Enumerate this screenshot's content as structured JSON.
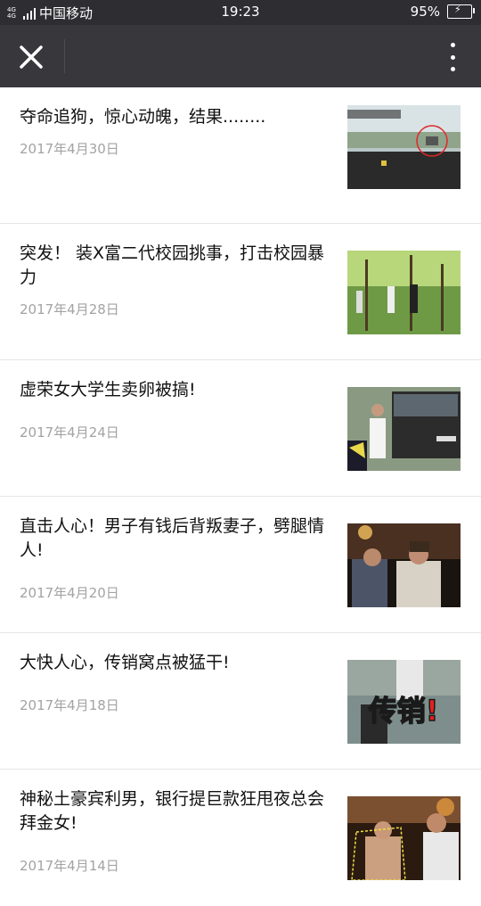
{
  "status_bar": {
    "network": "4G 4G",
    "carrier": "中国移动",
    "time": "19:23",
    "battery_percent": "95%",
    "battery_level": 0.95
  },
  "title_bar": {
    "close_icon": "close-icon",
    "more_icon": "more-vertical-icon"
  },
  "articles": [
    {
      "title": "夺命追狗，惊心动魄，结果........",
      "date": "2017年4月30日"
    },
    {
      "title": "突发！ 装X富二代校园挑事，打击校园暴力",
      "date": "2017年4月28日"
    },
    {
      "title": "虚荣女大学生卖卵被搞!",
      "date": "2017年4月24日"
    },
    {
      "title": "直击人心！男子有钱后背叛妻子，劈腿情人!",
      "date": "2017年4月20日"
    },
    {
      "title": "大快人心，传销窝点被猛干!",
      "date": "2017年4月18日",
      "thumb_text": "传销!"
    },
    {
      "title": "神秘土豪宾利男，银行提巨款狂甩夜总会拜金女!",
      "date": "2017年4月14日"
    }
  ]
}
